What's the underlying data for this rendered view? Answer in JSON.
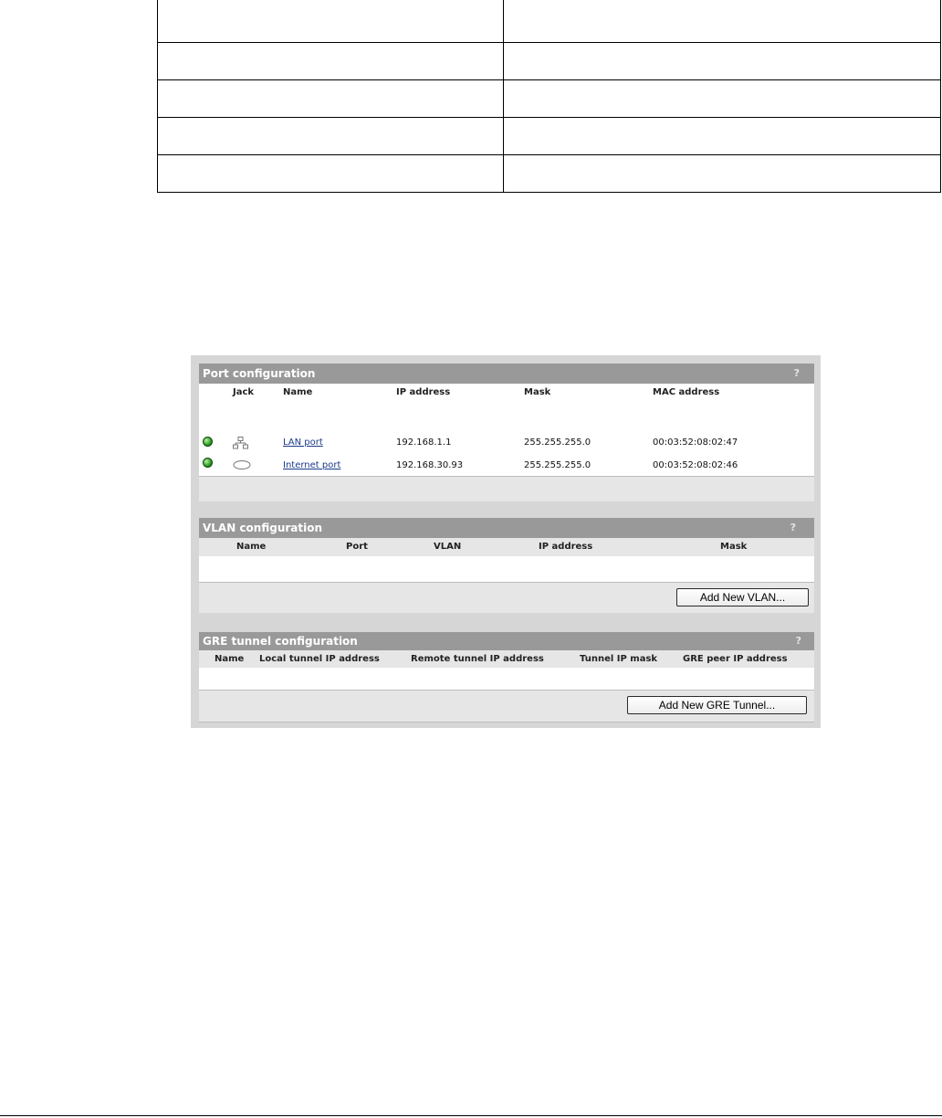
{
  "port_section": {
    "title": "Port configuration",
    "help": "?",
    "columns": {
      "jack": "Jack",
      "name": "Name",
      "ip": "IP address",
      "mask": "Mask",
      "mac": "MAC address"
    },
    "rows": [
      {
        "status": "green",
        "jack_icon": "network-jack-icon",
        "name": "LAN port",
        "ip": "192.168.1.1",
        "mask": "255.255.255.0",
        "mac": "00:03:52:08:02:47"
      },
      {
        "status": "green",
        "jack_icon": "internet-cloud-icon",
        "name": "Internet port",
        "ip": "192.168.30.93",
        "mask": "255.255.255.0",
        "mac": "00:03:52:08:02:46"
      }
    ]
  },
  "vlan_section": {
    "title": "VLAN configuration",
    "help": "?",
    "columns": {
      "name": "Name",
      "port": "Port",
      "vlan": "VLAN",
      "ip": "IP address",
      "mask": "Mask"
    },
    "add_button": "Add New VLAN..."
  },
  "gre_section": {
    "title": "GRE tunnel configuration",
    "help": "?",
    "columns": {
      "name": "Name",
      "local": "Local tunnel IP address",
      "remote": "Remote tunnel IP address",
      "mask": "Tunnel IP mask",
      "peer": "GRE peer IP address"
    },
    "add_button": "Add New GRE Tunnel..."
  },
  "colors": {
    "title_bar": "#999999",
    "panel_bg": "#d6d6d6",
    "link": "#1a3a8c",
    "status_green": "#2a9a22"
  }
}
